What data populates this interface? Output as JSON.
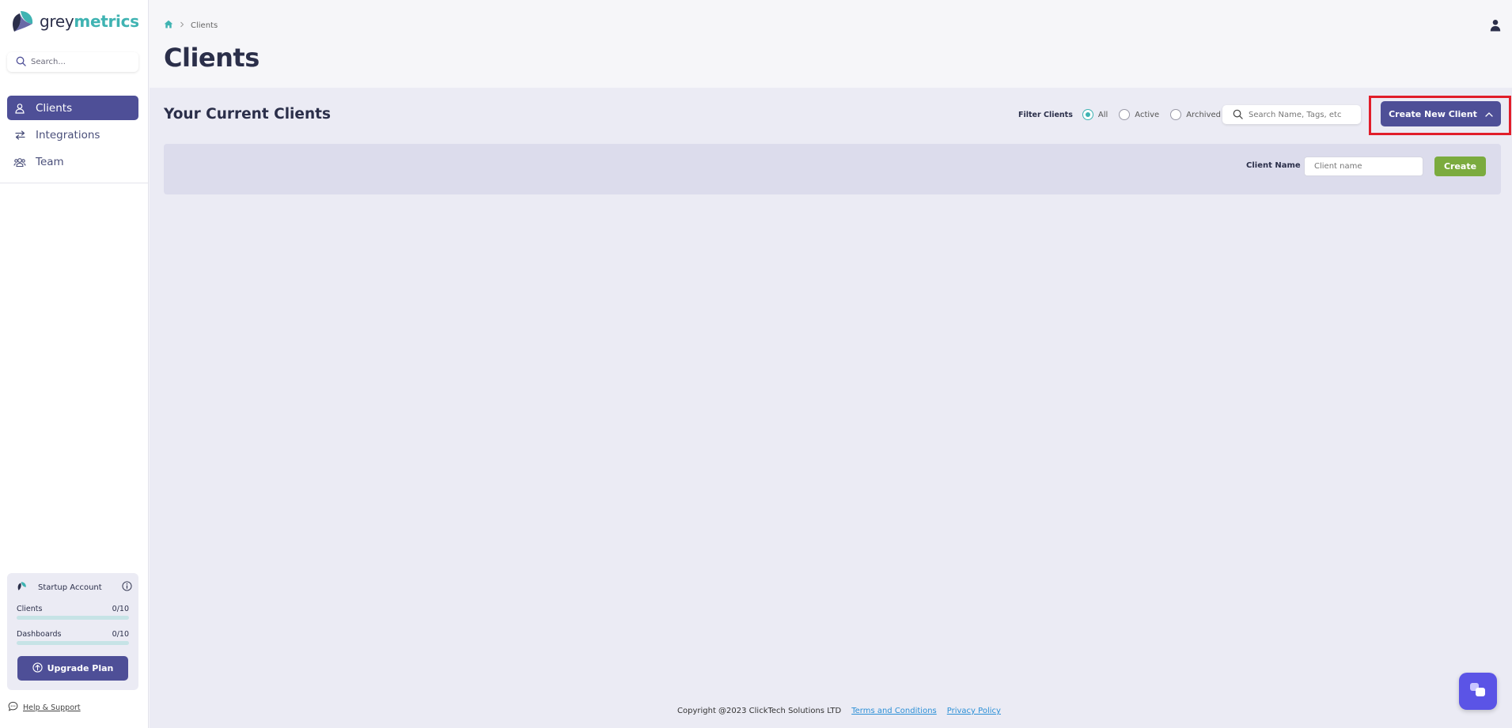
{
  "brand": {
    "name_part1": "grey",
    "name_part2": "metrics"
  },
  "sidebar": {
    "search_placeholder": "Search...",
    "items": [
      {
        "label": "Clients",
        "icon": "user-icon",
        "active": true
      },
      {
        "label": "Integrations",
        "icon": "arrows-swap-icon",
        "active": false
      },
      {
        "label": "Team",
        "icon": "team-icon",
        "active": false
      }
    ],
    "plan": {
      "name": "Startup Account",
      "clients_label": "Clients",
      "clients_value": "0/10",
      "clients_fraction": 0,
      "dashboards_label": "Dashboards",
      "dashboards_value": "0/10",
      "dashboards_fraction": 0,
      "upgrade_label": "Upgrade Plan"
    },
    "help_label": "Help & Support"
  },
  "header": {
    "breadcrumb": "Clients",
    "title": "Clients"
  },
  "main": {
    "section_title": "Your Current Clients",
    "filter_label": "Filter Clients",
    "filter_options": [
      "All",
      "Active",
      "Archived"
    ],
    "filter_selected": "All",
    "search_placeholder": "Search Name, Tags, etc",
    "create_new_label": "Create New Client",
    "create_panel": {
      "label": "Client Name",
      "input_placeholder": "Client name",
      "button_label": "Create"
    }
  },
  "footer": {
    "copyright": "Copyright @2023 ClickTech Solutions LTD",
    "terms": "Terms and Conditions",
    "privacy": "Privacy Policy"
  },
  "colors": {
    "primary": "#4e4f97",
    "accent": "#3fb3b2",
    "create_green": "#7bab3e",
    "highlight_red": "#e11d2a",
    "chat": "#5b54e6"
  }
}
